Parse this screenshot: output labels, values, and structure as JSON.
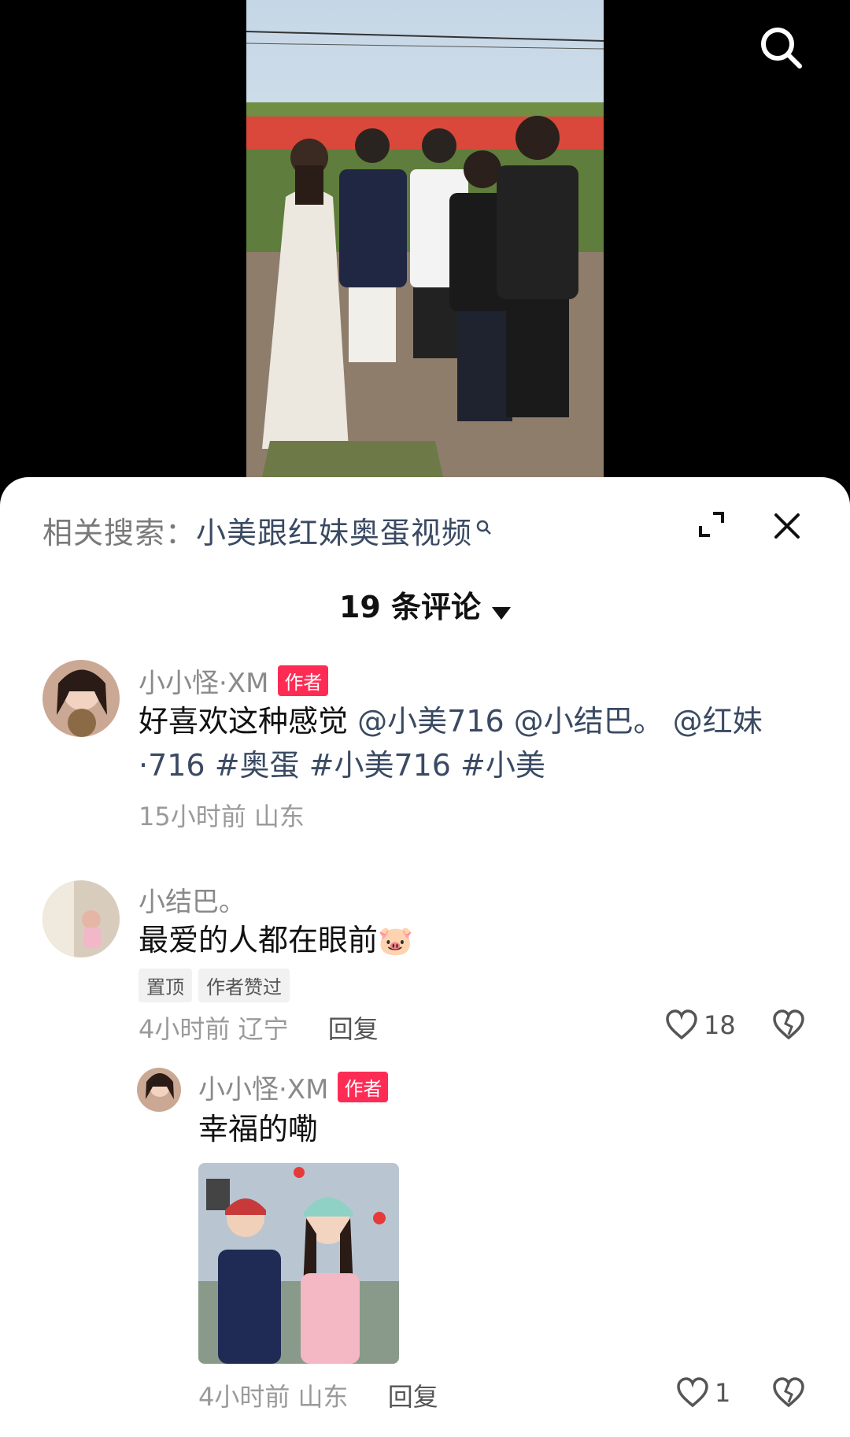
{
  "related_search": {
    "prefix": "相关搜索：",
    "query": "小美跟红妹奥蛋视频"
  },
  "comments_header": {
    "count_label": "19 条评论"
  },
  "comments": [
    {
      "user": "小小怪·XM",
      "badge": "作者",
      "text": "好喜欢这种感觉",
      "mentions": "@小美716 @小结巴。 @红妹·716 #奥蛋 #小美716 #小美",
      "time": "15小时前",
      "location": "山东"
    },
    {
      "user": "小结巴。",
      "text": "最爱的人都在眼前",
      "emoji": "🐷",
      "tags": [
        "置顶",
        "作者赞过"
      ],
      "time": "4小时前",
      "location": "辽宁",
      "reply_label": "回复",
      "likes": "18",
      "replies": [
        {
          "user": "小小怪·XM",
          "badge": "作者",
          "text": "幸福的嘞",
          "time": "4小时前",
          "location": "山东",
          "reply_label": "回复",
          "likes": "1"
        }
      ]
    }
  ],
  "colors": {
    "author_badge": "#fe2c55",
    "mention": "#3a4a63"
  }
}
